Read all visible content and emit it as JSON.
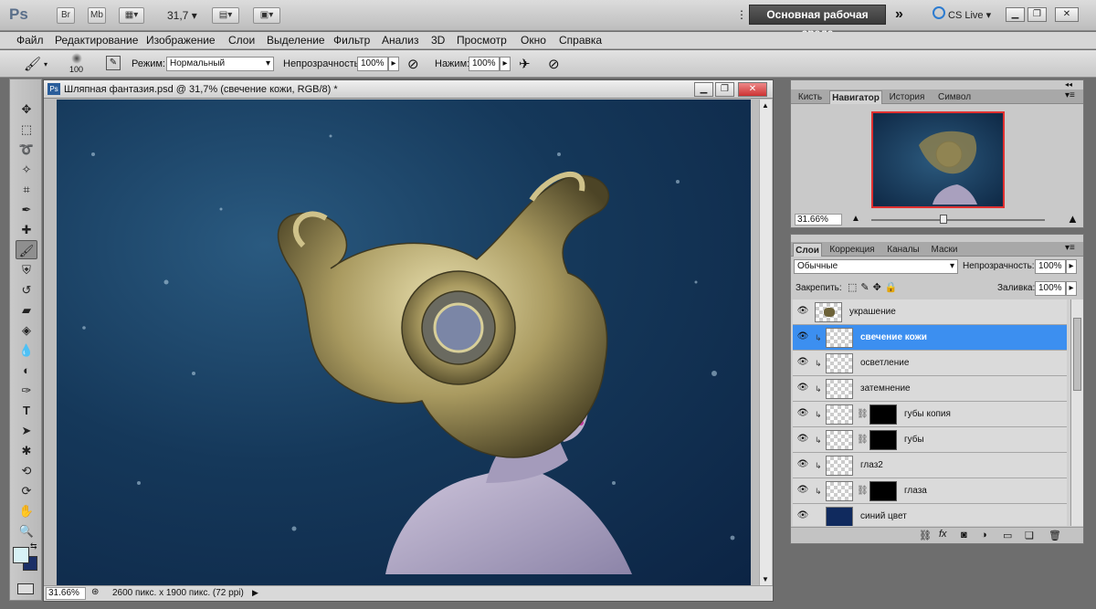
{
  "appbar": {
    "logo": "Ps",
    "br": "Br",
    "mb": "Mb",
    "zoom": "31,7",
    "workspace": "Основная рабочая среда",
    "more": "»",
    "cs_live": "CS Live"
  },
  "menu": [
    "Файл",
    "Редактирование",
    "Изображение",
    "Слои",
    "Выделение",
    "Фильтр",
    "Анализ",
    "3D",
    "Просмотр",
    "Окно",
    "Справка"
  ],
  "options": {
    "brush_size": "100",
    "mode_label": "Режим:",
    "mode_value": "Нормальный",
    "opacity_label": "Непрозрачность:",
    "opacity_value": "100%",
    "flow_label": "Нажим:",
    "flow_value": "100%"
  },
  "document": {
    "title": "Шляпная фантазия.psd @ 31,7% (свечение кожи, RGB/8) *",
    "status_zoom": "31.66%",
    "status_info": "2600 пикс. x 1900 пикс. (72 ppi)"
  },
  "navigator": {
    "tabs": [
      "Кисть",
      "Навигатор",
      "История",
      "Символ"
    ],
    "active_tab": 1,
    "zoom": "31.66%"
  },
  "layers_panel": {
    "tabs": [
      "Слои",
      "Коррекция",
      "Каналы",
      "Маски"
    ],
    "active_tab": 0,
    "blend_mode": "Обычные",
    "opacity_label": "Непрозрачность:",
    "opacity_value": "100%",
    "lock_label": "Закрепить:",
    "fill_label": "Заливка:",
    "fill_value": "100%",
    "layers": [
      {
        "name": "украшение",
        "mask": false,
        "selected": false,
        "clipped": false,
        "thumb": "ornament"
      },
      {
        "name": "свечение кожи",
        "mask": false,
        "selected": true,
        "clipped": true,
        "thumb": "transparent"
      },
      {
        "name": "осветление",
        "mask": false,
        "selected": false,
        "clipped": true,
        "thumb": "transparent"
      },
      {
        "name": "затемнение",
        "mask": false,
        "selected": false,
        "clipped": true,
        "thumb": "transparent"
      },
      {
        "name": "губы копия",
        "mask": true,
        "selected": false,
        "clipped": true,
        "thumb": "transparent"
      },
      {
        "name": "губы",
        "mask": true,
        "selected": false,
        "clipped": true,
        "thumb": "transparent"
      },
      {
        "name": "глаз2",
        "mask": false,
        "selected": false,
        "clipped": true,
        "thumb": "transparent"
      },
      {
        "name": "глаза",
        "mask": true,
        "selected": false,
        "clipped": true,
        "thumb": "transparent"
      },
      {
        "name": "синий цвет",
        "mask": false,
        "selected": false,
        "clipped": false,
        "thumb": "blue"
      }
    ]
  },
  "colors": {
    "foreground": "#d8f2f6",
    "background": "#1b2f66",
    "selection": "#3c8ff0"
  }
}
